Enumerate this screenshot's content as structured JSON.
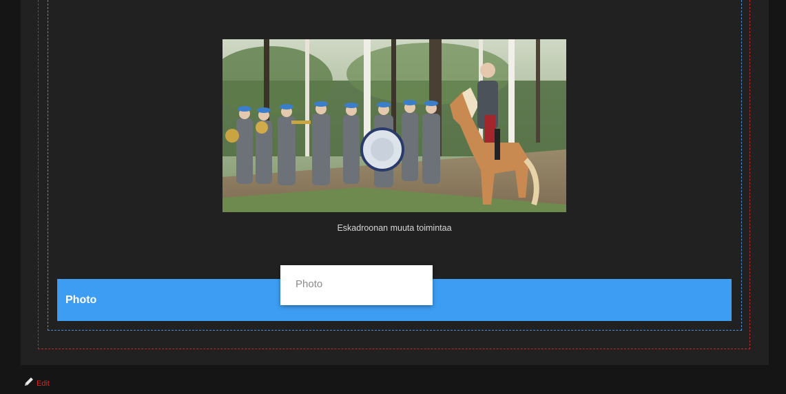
{
  "photo": {
    "caption": "Eskadroonan muuta toimintaa"
  },
  "photo_bar": {
    "label": "Photo"
  },
  "dropdown": {
    "items": [
      "Photo"
    ]
  },
  "edit": {
    "label": "Edit",
    "icon": "pencil-icon"
  },
  "colors": {
    "background": "#151515",
    "panel": "#212121",
    "accent_bar": "#3d9df2",
    "edit_red": "#e0241d",
    "guide_red": "#c0292b",
    "guide_blue": "#4a8ed8"
  }
}
